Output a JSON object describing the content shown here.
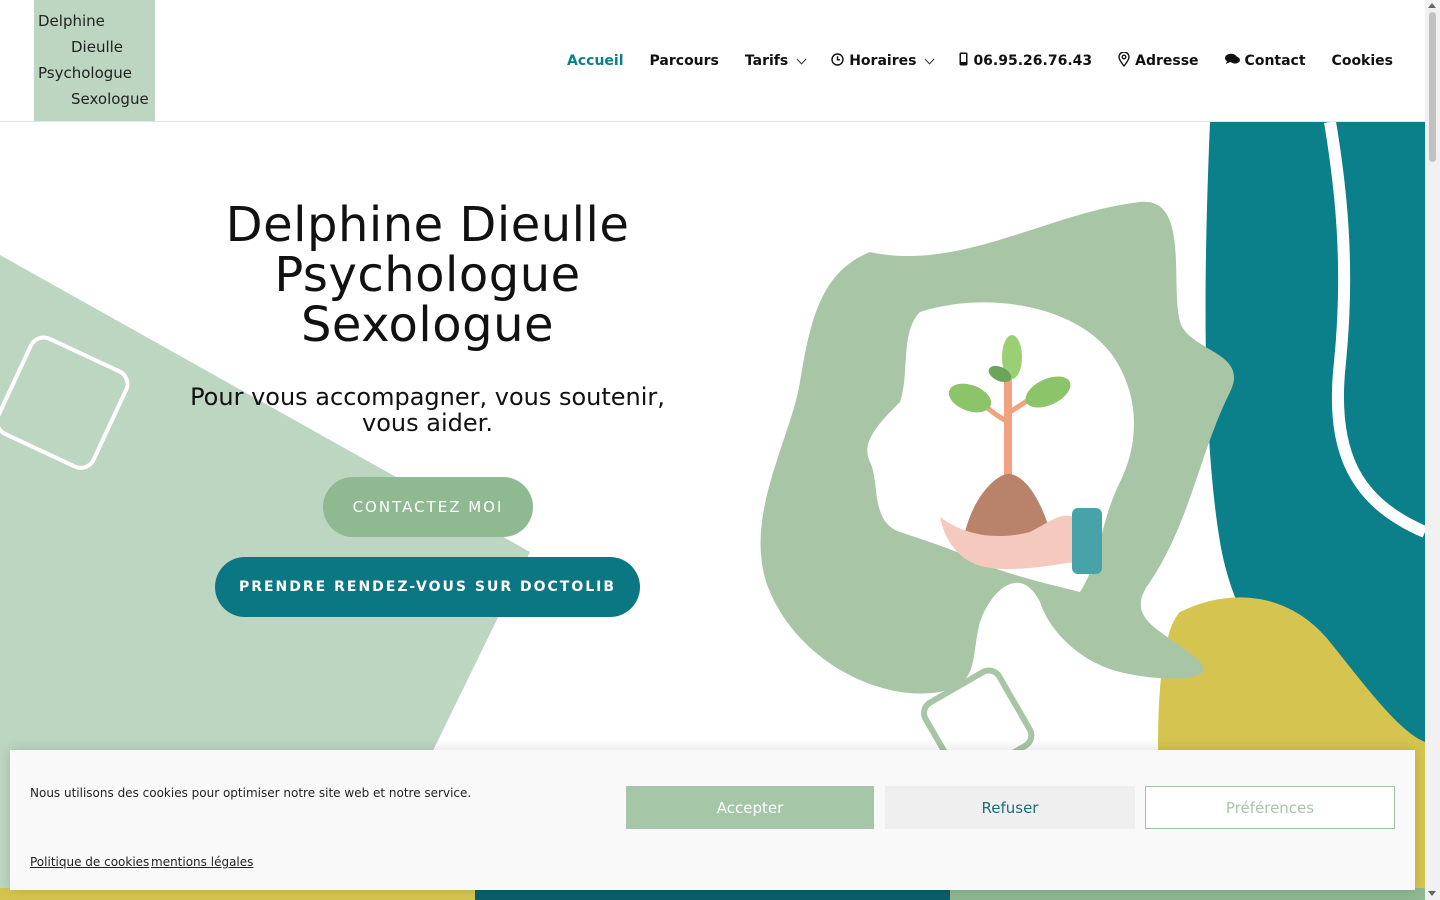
{
  "header": {
    "logo_lines": [
      "Delphine",
      "Dieulle",
      "Psychologue",
      "Sexologue"
    ],
    "nav": [
      {
        "label": "Accueil",
        "active": true
      },
      {
        "label": "Parcours"
      },
      {
        "label": "Tarifs",
        "dropdown": true
      },
      {
        "label": "Horaires",
        "icon": "clock-icon",
        "dropdown": true
      },
      {
        "label": "06.95.26.76.43",
        "icon": "phone-icon"
      },
      {
        "label": "Adresse",
        "icon": "map-pin-icon"
      },
      {
        "label": "Contact",
        "icon": "chat-icon"
      },
      {
        "label": "Cookies"
      }
    ]
  },
  "hero": {
    "title_lines": [
      "Delphine Dieulle",
      "Psychologue",
      "Sexologue"
    ],
    "subtitle": "Pour vous accompagner, vous soutenir, vous aider.",
    "contact_button": "CONTACTEZ MOI",
    "doctolib_button": "PRENDRE RENDEZ-VOUS SUR DOCTOLIB"
  },
  "cookie_banner": {
    "message": "Nous utilisons des cookies pour optimiser notre site web et notre service.",
    "accept": "Accepter",
    "refuse": "Refuser",
    "preferences": "Préférences",
    "policy_link": "Politique de cookies",
    "legal_link": "mentions légales"
  },
  "colors": {
    "accent_teal": "#0b7783",
    "sage_green": "#a6c6a8",
    "mustard": "#d4c44d"
  }
}
